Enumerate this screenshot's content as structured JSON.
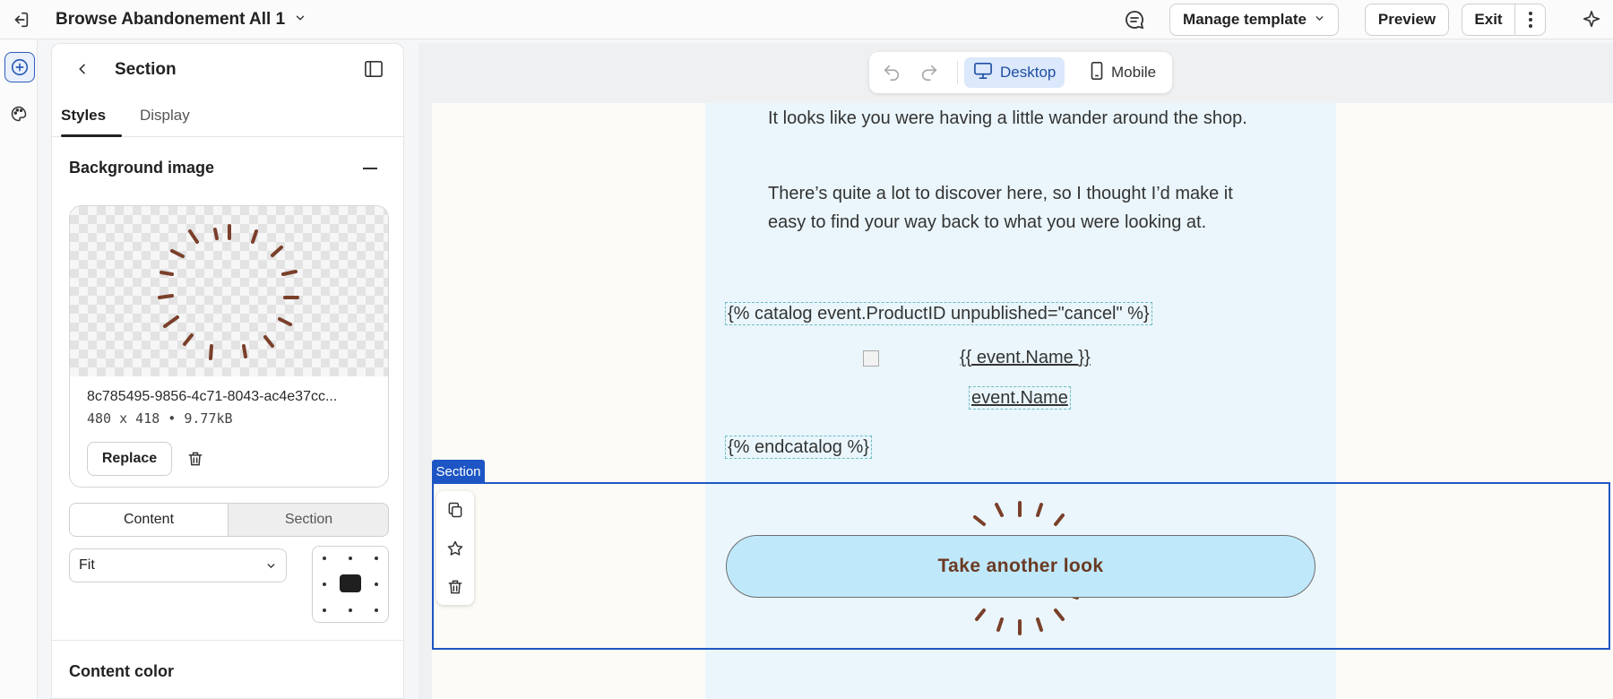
{
  "header": {
    "title": "Browse Abandonement All 1",
    "manage_label": "Manage template",
    "preview_label": "Preview",
    "exit_label": "Exit"
  },
  "panel": {
    "title": "Section",
    "tabs": [
      "Styles",
      "Display"
    ],
    "bg_heading": "Background image",
    "image": {
      "name": "8c785495-9856-4c71-8043-ac4e37cc...",
      "meta": "480 x 418 • 9.77kB",
      "replace_label": "Replace"
    },
    "segment": [
      "Content",
      "Section"
    ],
    "fit_value": "Fit",
    "content_color_heading": "Content color"
  },
  "toolbar": {
    "desktop_label": "Desktop",
    "mobile_label": "Mobile"
  },
  "email": {
    "para1": "It looks like you were having a little wander around the shop.",
    "para2": "There’s quite a lot to discover here, so I thought I’d make it easy to find your way back to what you were looking at.",
    "catalog_tag": "{% catalog event.ProductID unpublished=\"cancel\" %}",
    "name_merge": "{{ event.Name }}",
    "name_link": "event.Name",
    "endcatalog_tag": "{% endcatalog %}",
    "section_label": "Section",
    "cta_label": "Take another look"
  },
  "colors": {
    "accent": "#1d56c4",
    "cta_bg": "#bfe8fb",
    "cta_text": "#6a3a22",
    "stroke_brown": "#7a3f2a"
  }
}
